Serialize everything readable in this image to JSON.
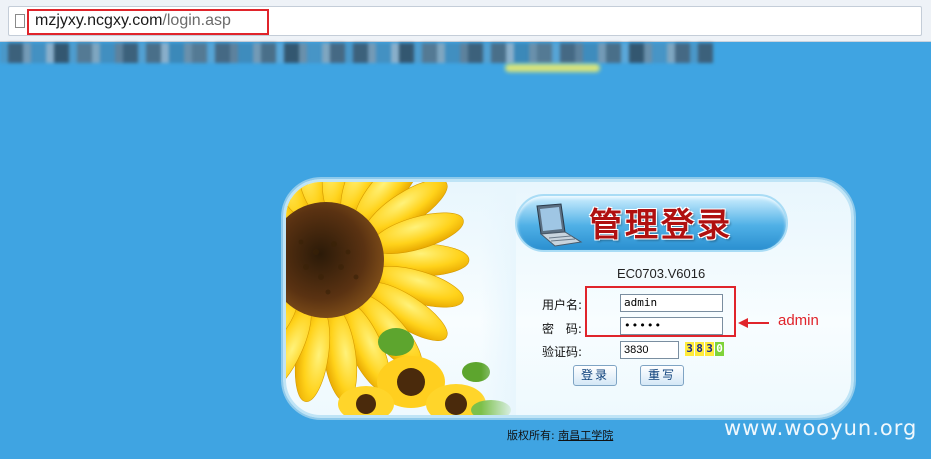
{
  "browser": {
    "url_host": "mzjyxy.ncgxy.com",
    "url_path": "/login.asp"
  },
  "login": {
    "title": "管理登录",
    "version": "EC0703.V6016",
    "username_label": "用户名:",
    "password_label": "密 码:",
    "captcha_label": "验证码:",
    "username_value": "admin",
    "password_value": "•••••",
    "captcha_value": "3830",
    "captcha_chars": [
      "3",
      "8",
      "3",
      "0"
    ],
    "login_button": "登录",
    "reset_button": "重写"
  },
  "annotation": {
    "text": "admin",
    "color": "#e0242b"
  },
  "footer": {
    "copyright_label": "版权所有:",
    "org_link": "南昌工学院"
  },
  "watermark": "www.wooyun.org",
  "colors": {
    "page_bg": "#3fa4e2",
    "title_red": "#b01010",
    "highlight_red": "#e0242b"
  }
}
